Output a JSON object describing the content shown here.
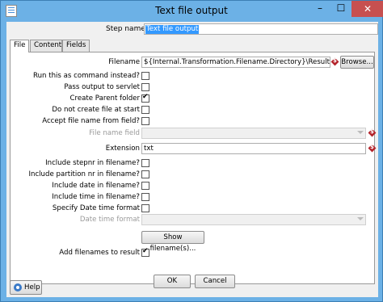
{
  "window": {
    "title": "Text file output"
  },
  "titlebar_buttons": {
    "minimize": "–",
    "maximize": "☐",
    "close": "✕"
  },
  "step": {
    "label": "Step name",
    "value": "Text file output"
  },
  "tabs": [
    {
      "label": "File",
      "active": true
    },
    {
      "label": "Content",
      "active": false
    },
    {
      "label": "Fields",
      "active": false
    }
  ],
  "fields": {
    "filename": {
      "label": "Filename",
      "value": "${Internal.Transformation.Filename.Directory}\\ResultsSampleD",
      "browse": "Browse..."
    },
    "run_as_command": {
      "label": "Run this as command instead?",
      "checked": false
    },
    "pass_to_servlet": {
      "label": "Pass output to servlet",
      "checked": false
    },
    "create_parent": {
      "label": "Create Parent folder",
      "checked": true
    },
    "no_create_at_start": {
      "label": "Do not create file at start",
      "checked": false
    },
    "accept_from_field": {
      "label": "Accept file name from field?",
      "checked": false
    },
    "file_name_field": {
      "label": "File name field",
      "value": ""
    },
    "extension": {
      "label": "Extension",
      "value": "txt"
    },
    "include_stepnr": {
      "label": "Include stepnr in filename?",
      "checked": false
    },
    "include_partition": {
      "label": "Include partition nr in filename?",
      "checked": false
    },
    "include_date": {
      "label": "Include date in filename?",
      "checked": false
    },
    "include_time": {
      "label": "Include time in filename?",
      "checked": false
    },
    "specify_date_format": {
      "label": "Specify Date time format",
      "checked": false
    },
    "date_time_format": {
      "label": "Date time format",
      "value": ""
    },
    "show_filenames": {
      "label": "Show filename(s)..."
    },
    "add_to_result": {
      "label": "Add filenames to result",
      "checked": true
    }
  },
  "footer": {
    "ok": "OK",
    "cancel": "Cancel",
    "help": "Help"
  },
  "colors": {
    "titlebar": "#6cb1e6",
    "selection": "#3399ff",
    "close": "#c75050"
  }
}
